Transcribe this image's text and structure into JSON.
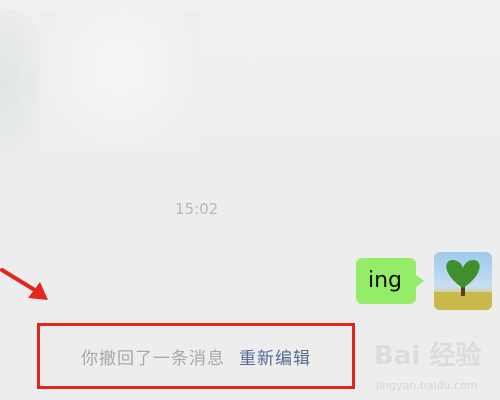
{
  "chat": {
    "timestamp": "15:02",
    "message": {
      "text": "ing"
    },
    "recall_notice": {
      "text": "你撤回了一条消息",
      "reedit_label": "重新编辑"
    }
  },
  "avatar": {
    "icon": "heart-tree-avatar"
  },
  "annotation": {
    "color": "#e3261d",
    "arrow_icon": "red-arrow-icon"
  },
  "watermark": {
    "logo": "Bai 经验",
    "url": "jingyan.baidu.com"
  },
  "colors": {
    "bubble": "#95ec69",
    "link": "#576b95",
    "background": "#ededed"
  }
}
